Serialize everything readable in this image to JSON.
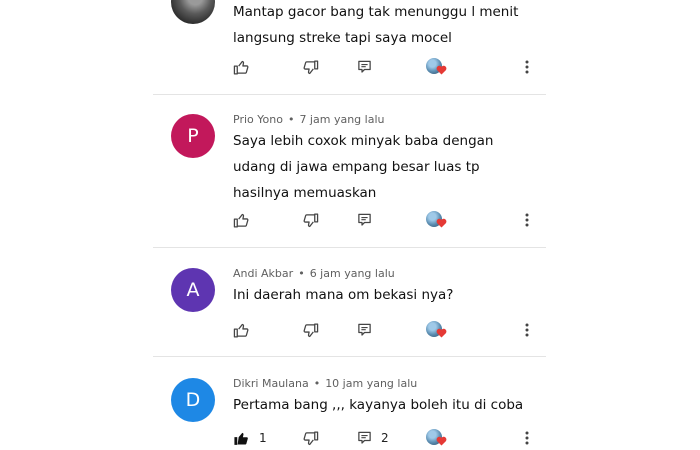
{
  "comments": [
    {
      "author": "",
      "time": "",
      "avatar_letter": "",
      "avatar_color": "",
      "text": "Mantap gacor bang tak menunggu l menit langsung streke tapi saya mocel",
      "like_count": "",
      "reply_count": "",
      "liked": false
    },
    {
      "author": "Prio Yono",
      "time": "7 jam yang lalu",
      "avatar_letter": "P",
      "avatar_color": "#c2185b",
      "text": "Saya lebih coxok minyak baba dengan udang  di jawa empang besar luas tp hasilnya memuaskan",
      "like_count": "",
      "reply_count": "",
      "liked": false
    },
    {
      "author": "Andi Akbar",
      "time": "6 jam yang lalu",
      "avatar_letter": "A",
      "avatar_color": "#5e35b1",
      "text": "Ini daerah mana om bekasi nya?",
      "like_count": "",
      "reply_count": "",
      "liked": false
    },
    {
      "author": "Dikri Maulana",
      "time": "10 jam yang lalu",
      "avatar_letter": "D",
      "avatar_color": "#1e88e5",
      "text": "Pertama bang ,,, kayanya boleh itu di coba",
      "like_count": "1",
      "reply_count": "2",
      "liked": true
    }
  ],
  "meta_separator": "•",
  "icons": {
    "like": "thumb-up-icon",
    "dislike": "thumb-down-icon",
    "reply": "reply-icon",
    "creator_heart": "creator-heart-icon",
    "more": "more-vert-icon"
  },
  "colors": {
    "heart": "#e53935",
    "icon": "#444444"
  }
}
